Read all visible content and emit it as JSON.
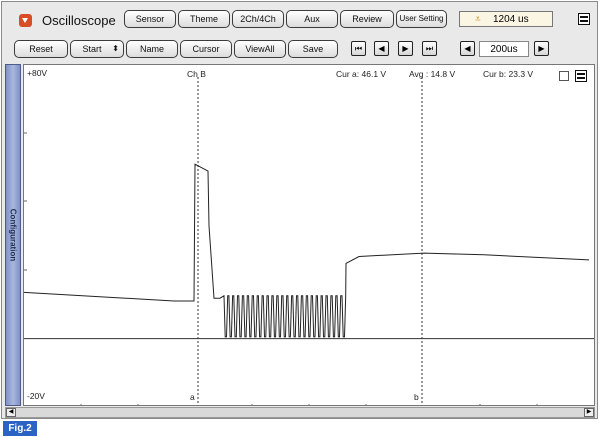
{
  "app": {
    "title": "Oscilloscope"
  },
  "toolbar1": {
    "buttons": [
      "Sensor",
      "Theme",
      "2Ch/4Ch",
      "Aux",
      "Review",
      "User Setting"
    ],
    "time_readout": "1204 us"
  },
  "toolbar2": {
    "buttons": [
      "Reset",
      "Start",
      "Name",
      "Cursor",
      "ViewAll",
      "Save"
    ],
    "start_spinner": "⬍",
    "nav": [
      "⏮",
      "◀",
      "▶",
      "⏭"
    ],
    "time_div": "200us"
  },
  "side_panel": {
    "label": "Configuration"
  },
  "plot": {
    "y_top": "+80V",
    "y_bottom": "-20V",
    "channel": "Ch B",
    "cur_a": "Cur a: 46.1 V",
    "avg": "Avg : 14.8 V",
    "cur_b": "Cur b: 23.3 V",
    "cursor_a": "a",
    "cursor_b": "b"
  },
  "chart_data": {
    "type": "line",
    "ylim": [
      -20,
      80
    ],
    "series": [
      {
        "values": [
          [
            0,
            13.5
          ],
          [
            150,
            11.0
          ],
          [
            170,
            11.0
          ],
          [
            171,
            51
          ],
          [
            184,
            49
          ],
          [
            185,
            33
          ],
          [
            190,
            11.8
          ],
          [
            196,
            11.8
          ],
          [
            200,
            12.5
          ],
          [
            300,
            12.5
          ],
          [
            313,
            14.5
          ],
          [
            322,
            22
          ],
          [
            335,
            24
          ],
          [
            400,
            25
          ],
          [
            460,
            24.5
          ],
          [
            565,
            23
          ]
        ]
      }
    ]
  },
  "footer": {
    "fig_label": "Fig.2"
  }
}
